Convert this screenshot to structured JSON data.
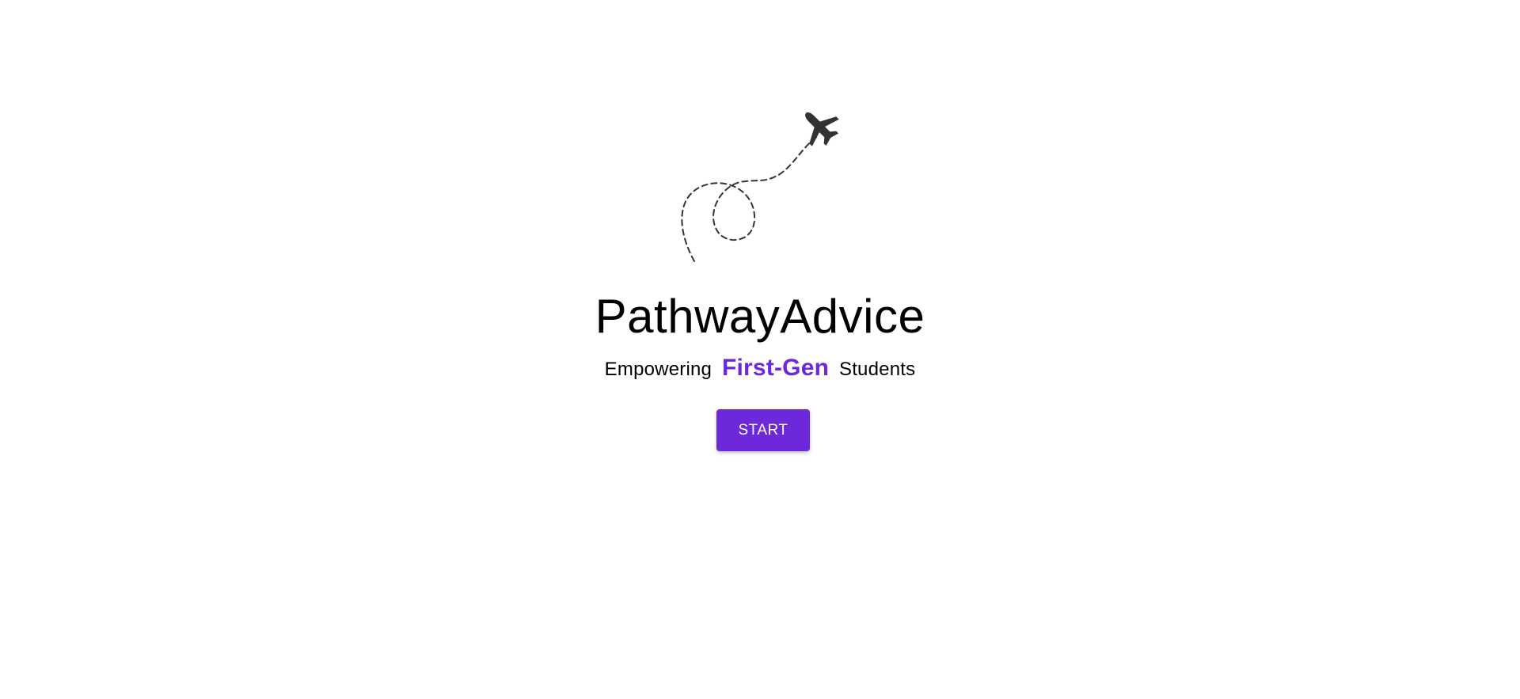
{
  "app": {
    "title": "PathwayAdvice"
  },
  "tagline": {
    "prefix": "Empowering",
    "highlight": "First-Gen",
    "suffix": "Students"
  },
  "actions": {
    "start_label": "START"
  },
  "icons": {
    "hero": "airplane-icon",
    "path": "dashed-flight-path"
  },
  "colors": {
    "accent": "#6D28D9",
    "button_bg": "#6D28D9",
    "button_text": "#FFFFFF",
    "icon": "#333333"
  }
}
